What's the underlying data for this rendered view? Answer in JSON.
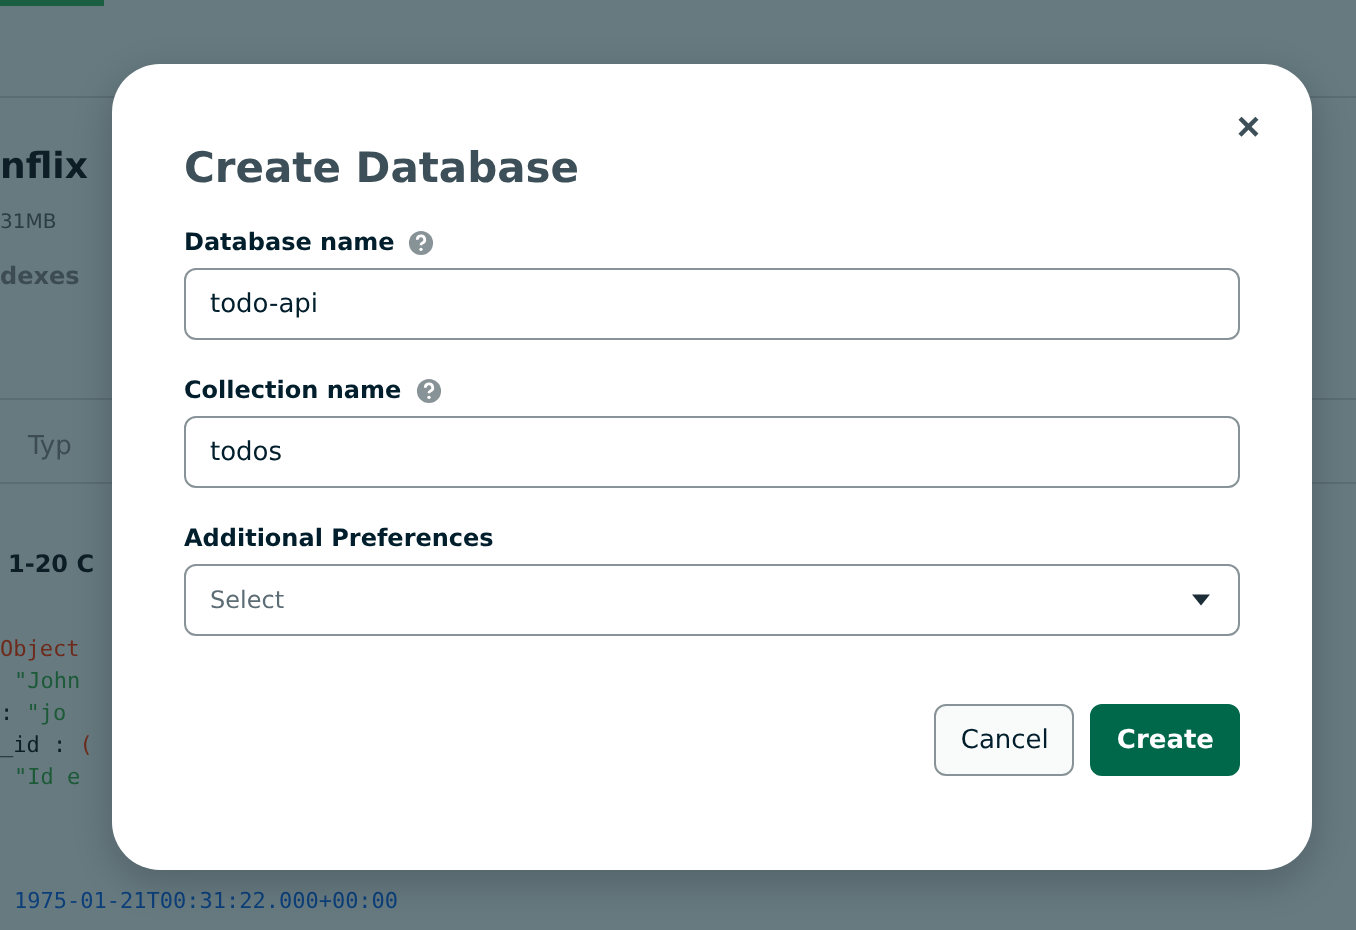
{
  "background": {
    "title": "nflix",
    "size": "31MB",
    "tab": "dexes",
    "column": "Typ",
    "results": "1-20 C",
    "code_lines": [
      {
        "parts": [
          {
            "text": "Object",
            "kind": "type"
          }
        ]
      },
      {
        "parts": [
          {
            "text": "\"John",
            "kind": "string"
          }
        ]
      },
      {
        "parts": [
          {
            "text": ": ",
            "kind": "key"
          },
          {
            "text": "\"jo",
            "kind": "string"
          }
        ]
      },
      {
        "parts": [
          {
            "text": "_id : ",
            "kind": "key"
          },
          {
            "text": "(",
            "kind": "type"
          }
        ]
      },
      {
        "parts": [
          {
            "text": "\"Id e",
            "kind": "string"
          }
        ]
      },
      {
        "parts": [
          {
            "text": "1975-01-21T00:31:22.000+00:00",
            "kind": "date"
          }
        ]
      }
    ]
  },
  "dialog": {
    "title": "Create Database",
    "close": "×",
    "fields": [
      {
        "kind": "text",
        "label": "Database name",
        "help": true,
        "value": "todo-api"
      },
      {
        "kind": "text",
        "label": "Collection name",
        "help": true,
        "value": "todos"
      },
      {
        "kind": "select",
        "label": "Additional Preferences",
        "help": false,
        "placeholder": "Select"
      }
    ],
    "buttons": [
      {
        "label": "Cancel",
        "kind": "secondary"
      },
      {
        "label": "Create",
        "kind": "primary"
      }
    ]
  }
}
